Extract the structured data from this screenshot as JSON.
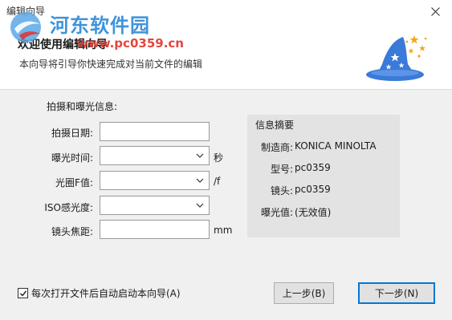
{
  "window": {
    "title": "编辑向导"
  },
  "header": {
    "title": "欢迎使用编辑向导",
    "subtitle": "本向导将引导你快速完成对当前文件的编辑"
  },
  "watermark": {
    "name": "河东软件园",
    "url": "www.pc0359.cn"
  },
  "form": {
    "group_title": "拍摄和曝光信息:",
    "fields": [
      {
        "label": "拍摄日期:",
        "value": "",
        "unit": ""
      },
      {
        "label": "曝光时间:",
        "value": "",
        "unit": "秒"
      },
      {
        "label": "光圈F值:",
        "value": "",
        "unit": "/f"
      },
      {
        "label": "ISO感光度:",
        "value": "",
        "unit": ""
      },
      {
        "label": "镜头焦距:",
        "value": "",
        "unit": "mm"
      }
    ]
  },
  "info": {
    "title": "信息摘要",
    "rows": [
      {
        "key": "制造商:",
        "value": "KONICA MINOLTA"
      },
      {
        "key": "型号:",
        "value": "pc0359"
      },
      {
        "key": "镜头:",
        "value": "pc0359"
      },
      {
        "key": "曝光值:",
        "value": "(无效值)"
      }
    ]
  },
  "footer": {
    "checkbox_label": "每次打开文件后自动启动本向导(A)",
    "checkbox_checked": true,
    "back_label": "上一步(B)",
    "next_label": "下一步(N)"
  },
  "colors": {
    "accent": "#0078d7",
    "hat": "#3a7ad8",
    "star": "#f2a51a"
  }
}
